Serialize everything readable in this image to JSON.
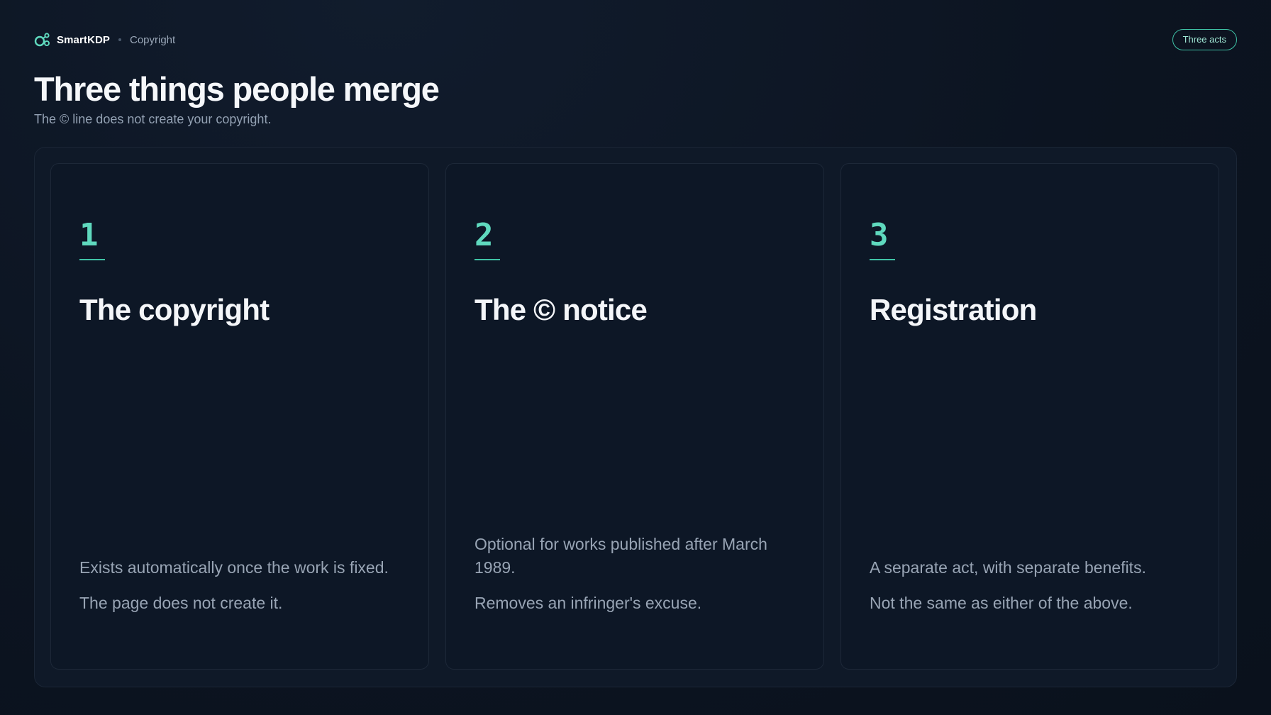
{
  "header": {
    "brand_name": "SmartKDP",
    "breadcrumb": "Copyright",
    "badge": "Three acts"
  },
  "page": {
    "title": "Three things people merge",
    "subtitle": "The © line does not create your copyright."
  },
  "colors": {
    "accent": "#5fd9be",
    "background": "#0c1421",
    "card": "#0d1726"
  },
  "cards": [
    {
      "number": "1",
      "title": "The copyright",
      "body": [
        "Exists automatically once the work is fixed.",
        "The page does not create it."
      ]
    },
    {
      "number": "2",
      "title": "The © notice",
      "body": [
        "Optional for works published after March 1989.",
        "Removes an infringer's excuse."
      ]
    },
    {
      "number": "3",
      "title": "Registration",
      "body": [
        "A separate act, with separate benefits.",
        "Not the same as either of the above."
      ]
    }
  ]
}
